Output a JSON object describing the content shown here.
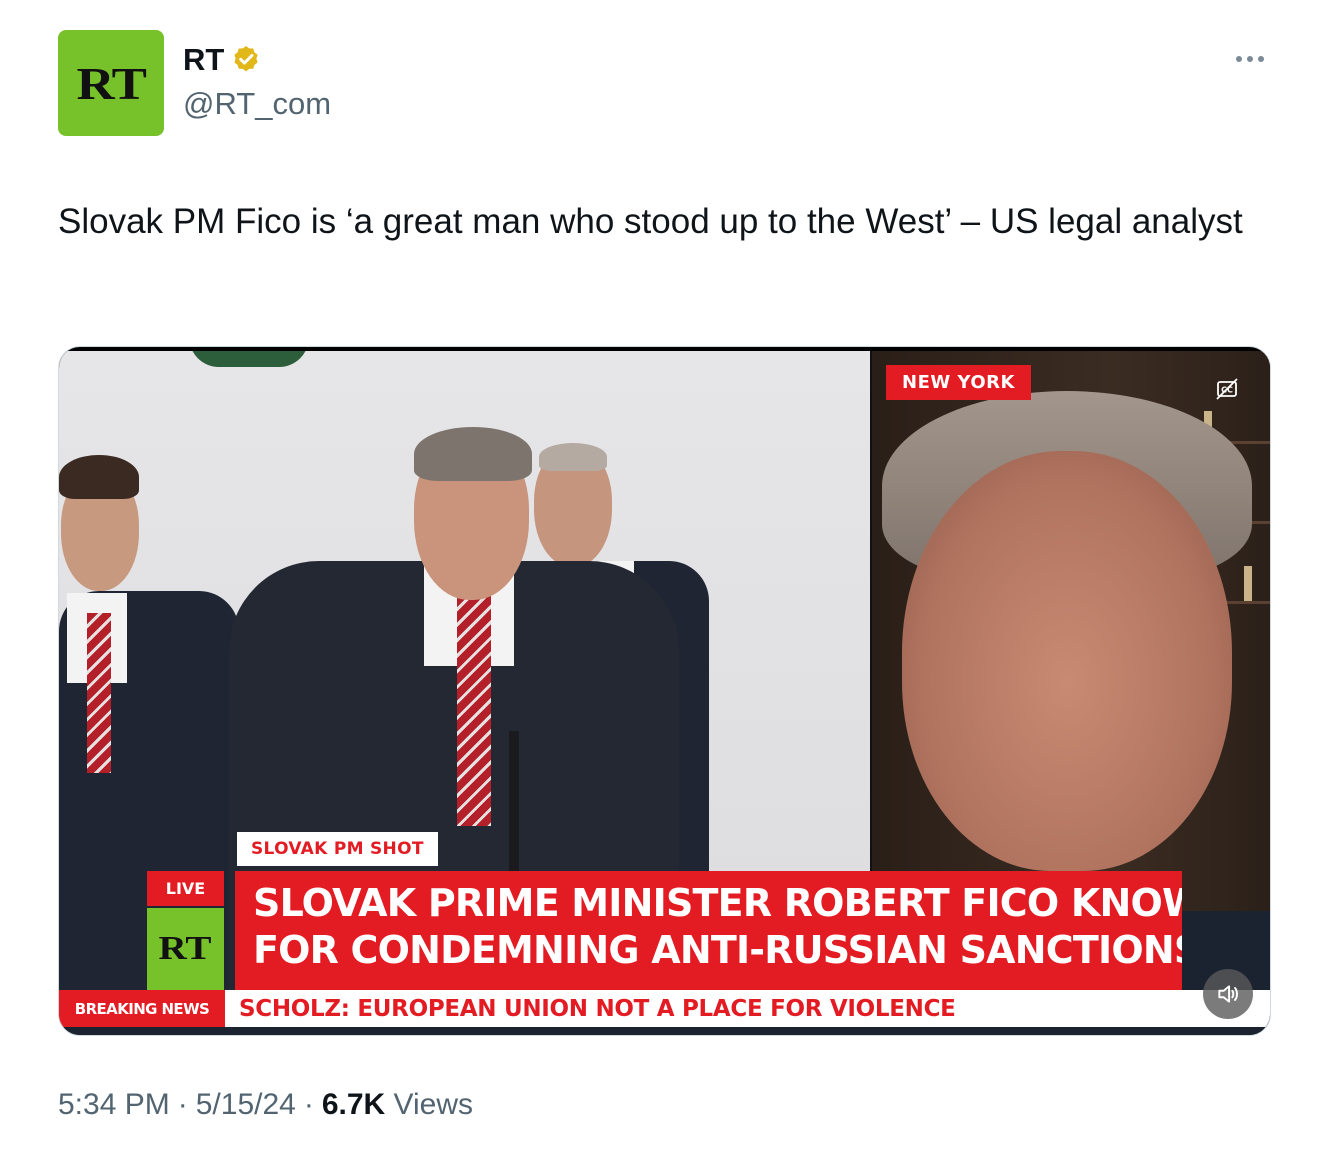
{
  "author": {
    "avatar_text": "RT",
    "avatar_color": "#77c12b",
    "display_name": "RT",
    "handle": "@RT_com",
    "verified_badge_color": "#e2b719"
  },
  "menu": {
    "icon": "more-horizontal-icon"
  },
  "tweet": {
    "text": "Slovak PM Fico is ‘a great man who stood up to the West’ – US legal analyst"
  },
  "video": {
    "location_tag": "NEW YORK",
    "slug": "SLOVAK PM SHOT",
    "live_label": "LIVE",
    "channel_logo": "RT",
    "headline_line1": "SLOVAK PRIME MINISTER ROBERT FICO KNOWN",
    "headline_line2": "FOR CONDEMNING ANTI-RUSSIAN SANCTIONS",
    "ticker_label": "BREAKING NEWS",
    "ticker_text": "SCHOLZ: EUROPEAN UNION NOT A PLACE FOR VIOLENCE",
    "accent_color": "#e31b23",
    "captions_icon": "closed-captions-off-icon",
    "volume_icon": "volume-icon"
  },
  "meta": {
    "time": "5:34 PM",
    "separator": "·",
    "date": "5/15/24",
    "views_count": "6.7K",
    "views_label": "Views"
  }
}
